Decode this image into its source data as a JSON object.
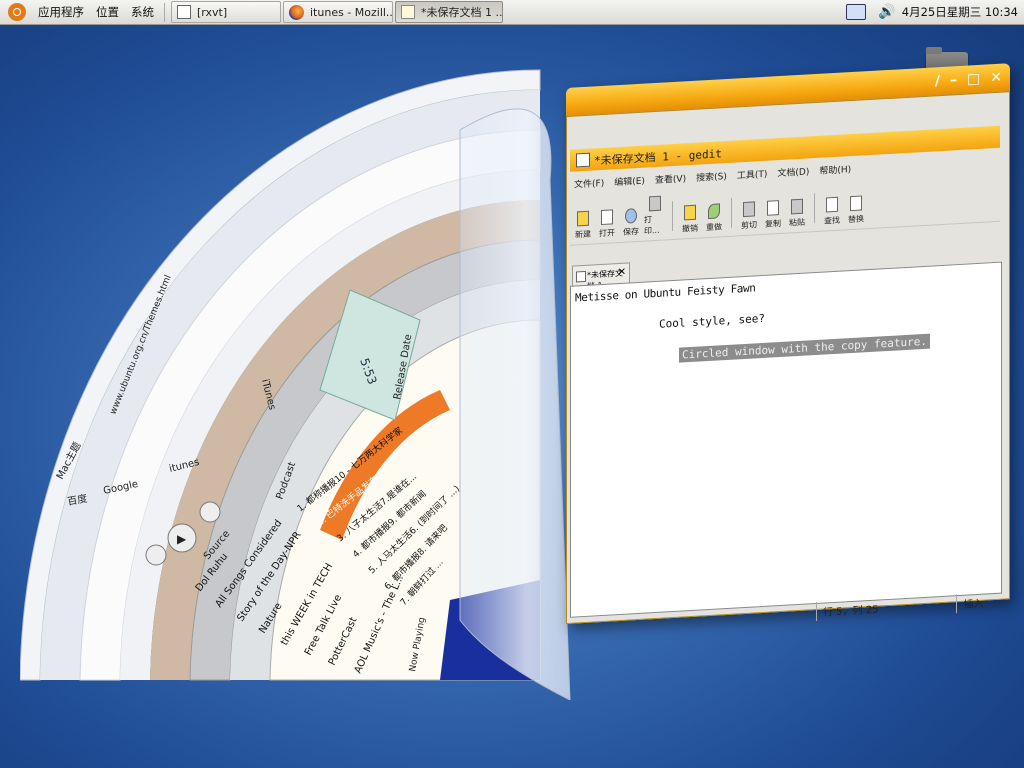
{
  "panel": {
    "menus": [
      "应用程序",
      "位置",
      "系统"
    ],
    "tasks": [
      {
        "label": "[rxvt]",
        "icon": "terminal-icon"
      },
      {
        "label": "itunes - Mozill...",
        "icon": "firefox-icon"
      },
      {
        "label": "*未保存文档 1 ...",
        "icon": "gedit-icon"
      }
    ],
    "clock": "4月25日星期三 10:34"
  },
  "itunes": {
    "browser_text": [
      "Mac主题",
      "itunes",
      "Google",
      "百度",
      "www.ubuntu.org.cn/Themes.html"
    ],
    "list_labels": [
      "Source",
      "Podcast",
      "iTunes",
      "Release Date"
    ],
    "sources": [
      "Dol Ruhu",
      "All Songs Considered",
      "Story of the Day-NPR",
      "Nature",
      "this WEEK in TECH",
      "Free Talk Live",
      "PotterCast",
      "AOL Music's - The L..."
    ],
    "podcasts": [
      "1. 都称播报10 - 七万两大科学家",
      "2. 巴特洗手品发布会",
      "3. 八子太生活7.是谁在...",
      "4. 都市播报9. 都市新闻",
      "5. 人马太生活6. (到时间了 ...)",
      "6. 都市播报8. 请来吧",
      "7. 朝鲜打过 ..."
    ],
    "display_text": "5:53",
    "now_playing": "Now Playing"
  },
  "gedit": {
    "inner_title": "*未保存文档 1 - gedit",
    "menubar": [
      "文件(F)",
      "编辑(E)",
      "查看(V)",
      "搜索(S)",
      "工具(T)",
      "文档(D)",
      "帮助(H)"
    ],
    "toolbar": [
      {
        "label": "新建",
        "icon": "new-icon"
      },
      {
        "label": "打开",
        "icon": "open-icon"
      },
      {
        "label": "保存",
        "icon": "save-icon"
      },
      {
        "label": "打印...",
        "icon": "print-icon"
      },
      {
        "label": "撤销",
        "icon": "undo-icon"
      },
      {
        "label": "重做",
        "icon": "redo-icon"
      },
      {
        "label": "剪切",
        "icon": "cut-icon"
      },
      {
        "label": "复制",
        "icon": "copy-icon"
      },
      {
        "label": "粘贴",
        "icon": "paste-icon"
      },
      {
        "label": "查找",
        "icon": "find-icon"
      },
      {
        "label": "替换",
        "icon": "replace-icon"
      }
    ],
    "tab_label": "*未保存文档 1",
    "text_lines": [
      "Metisse on Ubuntu Feisty Fawn",
      "Cool style, see?",
      "Circled window with the copy feature."
    ],
    "status_position": "行 5，列 25",
    "status_mode": "插入"
  }
}
